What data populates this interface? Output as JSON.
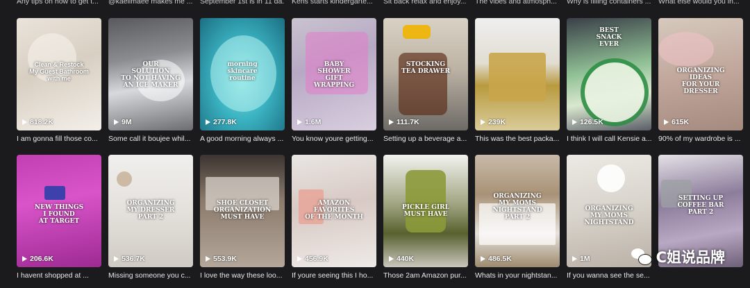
{
  "top_captions": [
    "Any tips on how to get t...",
    "@kaelimaee makes me ...",
    "September 1st is in 11 da...",
    "Kens starts kindergarte...",
    "Sit back relax and enjoy...",
    "The vibes and atmosph...",
    "Why is filling containers ...",
    "What else would you in..."
  ],
  "row1": [
    {
      "overlay": "Clean & Restock\nMy Guest Bathroom\nwith me",
      "views": "818.2K",
      "caption": "I am gonna fill those co..."
    },
    {
      "overlay": "OUR\nSOLUTION\nTO NOT HAVING\nAN ICE MAKER",
      "views": "9M",
      "caption": "Some call it boujee whil..."
    },
    {
      "overlay": "morning\nskincare\nroutine",
      "views": "277.8K",
      "caption": "A good morning always ..."
    },
    {
      "overlay": "BABY\nSHOWER\nGIFT\nWRAPPING",
      "views": "1.6M",
      "caption": "You know youre getting..."
    },
    {
      "overlay": "STOCKING\nTEA DRAWER",
      "views": "111.7K",
      "caption": "Setting up a beverage a..."
    },
    {
      "overlay": "",
      "views": "239K",
      "caption": "This was the best packa..."
    },
    {
      "overlay": "BEST\nSNACK\nEVER",
      "views": "126.5K",
      "caption": "I think I will call Kensie a..."
    },
    {
      "overlay": "ORGANIZING\nIDEAS\nFOR YOUR\nDRESSER",
      "views": "615K",
      "caption": "90% of my wardrobe is ..."
    }
  ],
  "row2": [
    {
      "overlay": "NEW THINGS\nI FOUND\nAT TARGET",
      "views": "206.6K",
      "caption": "I havent shopped at ..."
    },
    {
      "overlay": "ORGANIZING\nMY DRESSER\nPART 2",
      "views": "536.7K",
      "caption": "Missing someone you c..."
    },
    {
      "overlay": "SHOE CLOSET\nORGANIZATION\nMUST HAVE",
      "views": "553.9K",
      "caption": "I love the way these loo..."
    },
    {
      "overlay": "AMAZON\nFAVORITES\nOF THE MONTH",
      "views": "456.9K",
      "caption": "If youre seeing this I ho..."
    },
    {
      "overlay": "PICKLE GIRL\nMUST HAVE",
      "views": "440K",
      "caption": "Those 2am Amazon pur..."
    },
    {
      "overlay": "ORGANIZING\nMY MOMS\nNIGHTSTAND\nPART 2",
      "views": "486.5K",
      "caption": "Whats in your nightstan..."
    },
    {
      "overlay": "ORGANIZING\nMY MOMS\nNIGHTSTAND",
      "views": "1M",
      "caption": "If you wanna see the se..."
    },
    {
      "overlay": "SETTING UP\nCOFFEE BAR\nPART 2",
      "views": "",
      "caption": ""
    }
  ],
  "watermark": {
    "text": "C姐说品牌",
    "icon": "wechat-icon"
  }
}
